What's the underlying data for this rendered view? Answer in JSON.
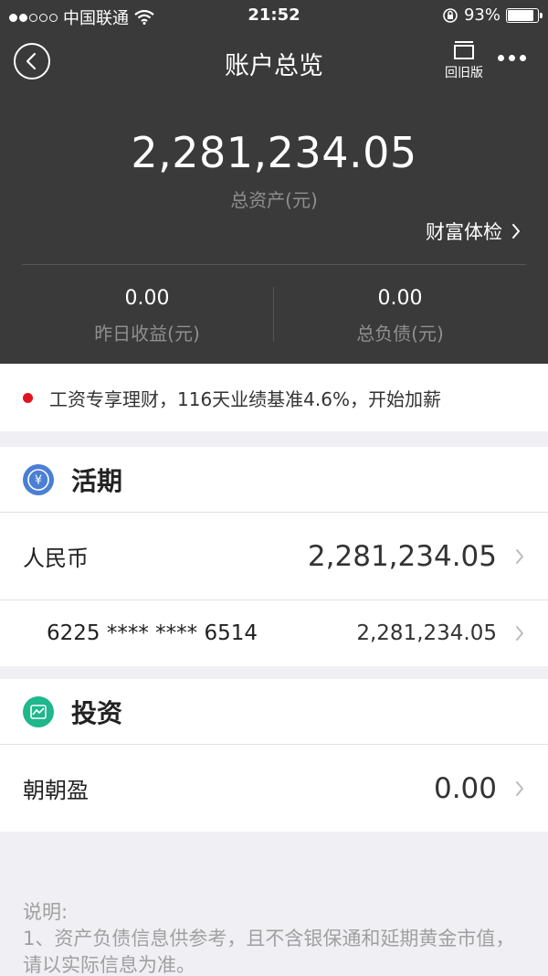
{
  "status_bar": {
    "carrier": "中国联通",
    "time": "21:52",
    "battery_percent": "93%",
    "battery_level": 0.93
  },
  "nav": {
    "title": "账户总览",
    "old_version_label": "回旧版"
  },
  "summary": {
    "total_assets": "2,281,234.05",
    "total_assets_label": "总资产(元)",
    "wealth_check_label": "财富体检",
    "yesterday_income": "0.00",
    "yesterday_income_label": "昨日收益(元)",
    "total_liabilities": "0.00",
    "total_liabilities_label": "总负债(元)"
  },
  "banner": {
    "text": "工资专享理财，116天业绩基准4.6%，开始加薪"
  },
  "current": {
    "title": "活期",
    "icon": "yuan-coin-icon",
    "icon_color": "#4a7fd4",
    "currency_label": "人民币",
    "currency_amount": "2,281,234.05",
    "card_number": "6225 **** **** 6514",
    "card_amount": "2,281,234.05"
  },
  "investment": {
    "title": "投资",
    "icon": "chart-icon",
    "icon_color": "#1fb78c",
    "product_label": "朝朝盈",
    "product_amount": "0.00"
  },
  "note": {
    "title": "说明:",
    "line1": "1、资产负债信息供参考，且不含银保通和延期黄金市值，请以实际信息为准。"
  },
  "colors": {
    "header_bg": "#3a3a3a",
    "page_bg": "#efeff4",
    "accent_red": "#e0141e"
  }
}
